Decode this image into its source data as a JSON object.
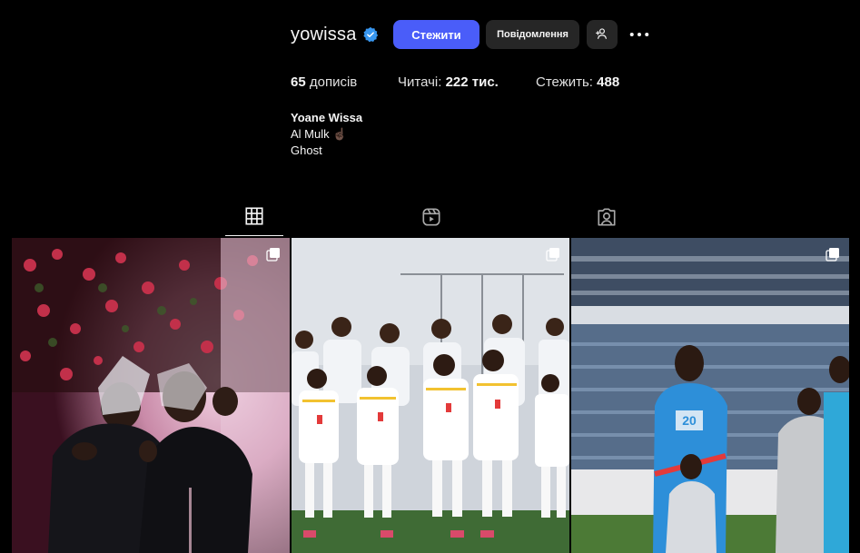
{
  "profile": {
    "username": "yowissa",
    "verified": true,
    "follow_label": "Стежити",
    "message_label": "Повідомлення",
    "posts_count": "65",
    "posts_label": "дописів",
    "followers_label": "Читачі:",
    "followers_count": "222 тис.",
    "following_label": "Стежить:",
    "following_count": "488",
    "bio_name": "Yoane Wissa",
    "bio_line1": "Al Mulk ☝🏿",
    "bio_line2": "Ghost"
  },
  "icons": {
    "verified": "verified-badge-icon",
    "add_user": "add-user-icon",
    "more": "more-options-icon",
    "tab_posts": "grid-icon",
    "tab_reels": "reels-icon",
    "tab_tagged": "tagged-icon",
    "carousel": "carousel-icon"
  },
  "colors": {
    "accent": "#4a5df9",
    "verified": "#3897f0",
    "background": "#000000",
    "button_secondary": "#262626"
  },
  "posts": [
    {
      "type": "carousel",
      "description": "two men in black shirts posing under flowers"
    },
    {
      "type": "carousel",
      "description": "team photo in white kits"
    },
    {
      "type": "carousel",
      "description": "players lined up with children in stadium"
    }
  ]
}
